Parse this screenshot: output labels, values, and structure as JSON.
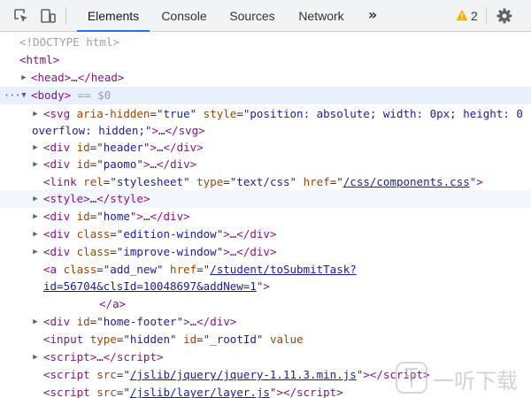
{
  "toolbar": {
    "inspect_icon": "inspect-element-icon",
    "device_icon": "device-toolbar-icon",
    "tabs": [
      {
        "label": "Elements",
        "active": true
      },
      {
        "label": "Console",
        "active": false
      },
      {
        "label": "Sources",
        "active": false
      },
      {
        "label": "Network",
        "active": false
      }
    ],
    "more_label": "»",
    "warnings_count": "2",
    "settings_icon": "gear-icon"
  },
  "tree": {
    "doctype": "<!DOCTYPE html>",
    "html_tag": "html",
    "head_tag": "head",
    "body_tag": "body",
    "selected_marker": "== $0",
    "ellipsis": "…",
    "svg": {
      "tag": "svg",
      "attr1": "aria-hidden",
      "val1": "true",
      "attr2": "style",
      "val2": "position: absolute; width: 0px; height: 0",
      "cont": "overflow: hidden;"
    },
    "div_header": {
      "tag": "div",
      "attr": "id",
      "val": "header"
    },
    "div_paomo": {
      "tag": "div",
      "attr": "id",
      "val": "paomo"
    },
    "link": {
      "tag": "link",
      "attr1": "rel",
      "val1": "stylesheet",
      "attr2": "type",
      "val2": "text/css",
      "attr3": "href",
      "val3": "/css/components.css"
    },
    "style_tag": "style",
    "div_home": {
      "tag": "div",
      "attr": "id",
      "val": "home"
    },
    "div_edition": {
      "tag": "div",
      "attr": "class",
      "val": "edition-window"
    },
    "div_improve": {
      "tag": "div",
      "attr": "class",
      "val": "improve-window"
    },
    "anchor": {
      "tag": "a",
      "attr1": "class",
      "val1": "add_new",
      "attr2": "href",
      "val2_line1": "/student/toSubmitTask?",
      "val2_line2": "id=56704&clsId=10048697&addNew=1"
    },
    "div_footer": {
      "tag": "div",
      "attr": "id",
      "val": "home-footer"
    },
    "input": {
      "tag": "input",
      "attr1": "type",
      "val1": "hidden",
      "attr2": "id",
      "val2": "_rootId",
      "attr3": "value"
    },
    "script_tag": "script",
    "script_jquery": {
      "attr": "src",
      "val": "/jslib/jquery/jquery-1.11.3.min.js"
    },
    "script_layer": {
      "attr": "src",
      "val": "/jslib/layer/layer.js"
    }
  },
  "watermark": {
    "text": "一听下载"
  },
  "colors": {
    "accent": "#1a73e8",
    "warning": "#f9ab00",
    "tag": "#881280",
    "attr_name": "#994500",
    "attr_value": "#1a1aa6"
  }
}
